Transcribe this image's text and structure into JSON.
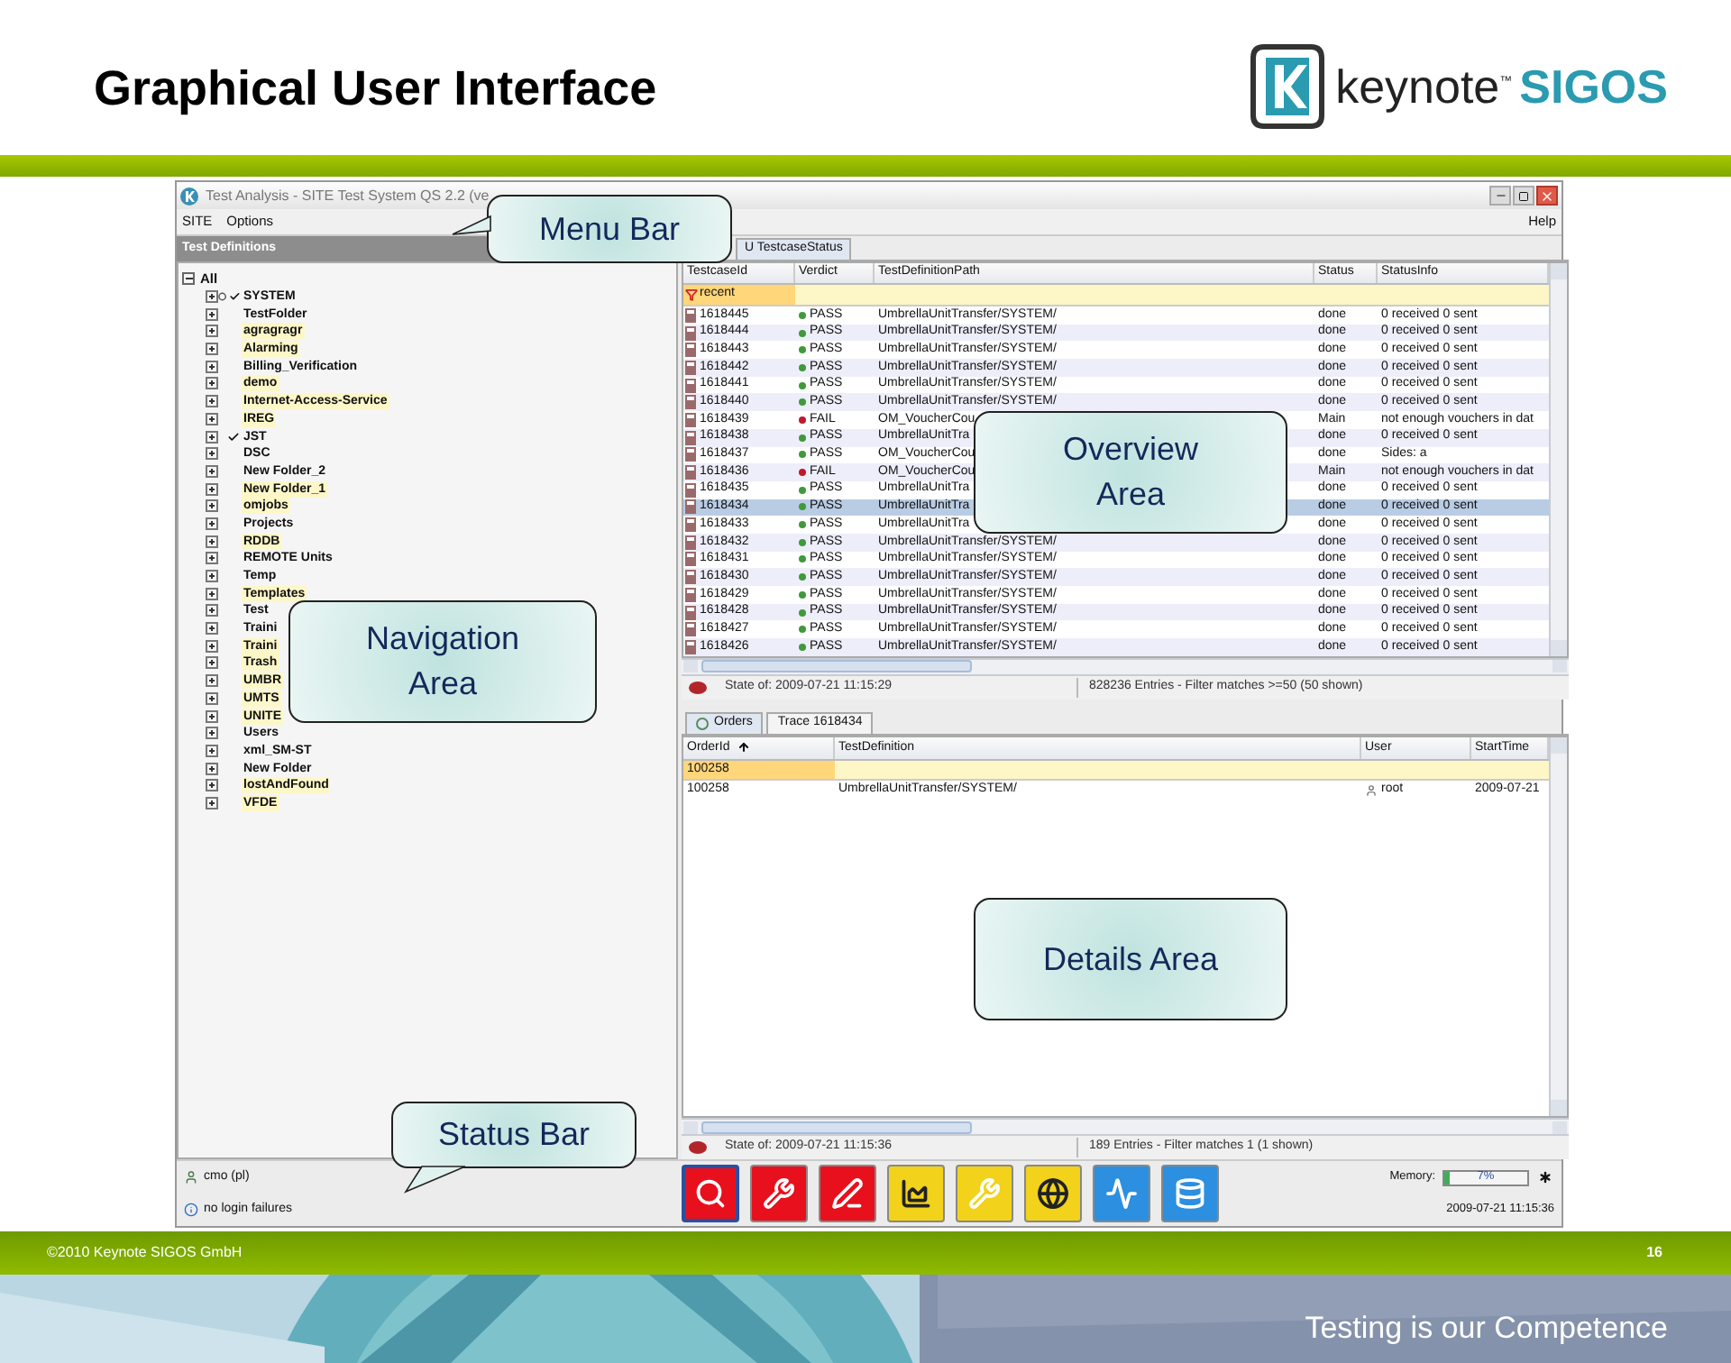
{
  "slide": {
    "title": "Graphical User Interface",
    "logo": {
      "word": "keynote",
      "mark": "™",
      "brand": "SIGOS"
    }
  },
  "window": {
    "title": "Test Analysis - SITE Test System QS 2.2 (ve",
    "menu": [
      "SITE",
      "Options"
    ],
    "help": "Help"
  },
  "navigation": {
    "header": "Test Definitions",
    "tree": {
      "label": "All",
      "expanded": true,
      "children": [
        {
          "label": "SYSTEM",
          "checked": true,
          "pinned": true,
          "highlighted": false,
          "expanded": false
        },
        {
          "label": "TestFolder",
          "checked": false,
          "pinned": false,
          "highlighted": false,
          "expanded": false
        },
        {
          "label": "agragragr",
          "checked": false,
          "pinned": false,
          "highlighted": true,
          "expanded": false
        },
        {
          "label": "Alarming",
          "checked": false,
          "pinned": false,
          "highlighted": true,
          "expanded": false
        },
        {
          "label": "Billing_Verification",
          "checked": false,
          "pinned": false,
          "highlighted": false,
          "expanded": false
        },
        {
          "label": "demo",
          "checked": false,
          "pinned": false,
          "highlighted": true,
          "expanded": false
        },
        {
          "label": "Internet-Access-Service",
          "checked": false,
          "pinned": false,
          "highlighted": true,
          "expanded": false
        },
        {
          "label": "IREG",
          "checked": false,
          "pinned": false,
          "highlighted": true,
          "expanded": false
        },
        {
          "label": "JST",
          "checked": true,
          "pinned": false,
          "highlighted": false,
          "expanded": false
        },
        {
          "label": "DSC",
          "checked": false,
          "pinned": false,
          "highlighted": false,
          "expanded": false
        },
        {
          "label": "New Folder_2",
          "checked": false,
          "pinned": false,
          "highlighted": false,
          "expanded": false
        },
        {
          "label": "New Folder_1",
          "checked": false,
          "pinned": false,
          "highlighted": true,
          "expanded": false
        },
        {
          "label": "omjobs",
          "checked": false,
          "pinned": false,
          "highlighted": true,
          "expanded": false
        },
        {
          "label": "Projects",
          "checked": false,
          "pinned": false,
          "highlighted": false,
          "expanded": false
        },
        {
          "label": "RDDB",
          "checked": false,
          "pinned": false,
          "highlighted": true,
          "expanded": false
        },
        {
          "label": "REMOTE Units",
          "checked": false,
          "pinned": false,
          "highlighted": false,
          "expanded": false
        },
        {
          "label": "Temp",
          "checked": false,
          "pinned": false,
          "highlighted": false,
          "expanded": false
        },
        {
          "label": "Templates",
          "checked": false,
          "pinned": false,
          "highlighted": true,
          "expanded": false
        },
        {
          "label": "Test",
          "checked": false,
          "pinned": false,
          "highlighted": false,
          "expanded": false
        },
        {
          "label": "Traini",
          "checked": false,
          "pinned": false,
          "highlighted": false,
          "expanded": false
        },
        {
          "label": "Traini",
          "checked": false,
          "pinned": false,
          "highlighted": true,
          "expanded": false
        },
        {
          "label": "Trash",
          "checked": false,
          "pinned": false,
          "highlighted": true,
          "expanded": false
        },
        {
          "label": "UMBR",
          "checked": false,
          "pinned": false,
          "highlighted": true,
          "expanded": false
        },
        {
          "label": "UMTS",
          "checked": false,
          "pinned": false,
          "highlighted": true,
          "expanded": false
        },
        {
          "label": "UNITE",
          "checked": false,
          "pinned": false,
          "highlighted": true,
          "expanded": false
        },
        {
          "label": "Users",
          "checked": false,
          "pinned": false,
          "highlighted": false,
          "expanded": false
        },
        {
          "label": "xml_SM-ST",
          "checked": false,
          "pinned": false,
          "highlighted": false,
          "expanded": false
        },
        {
          "label": "New Folder",
          "checked": false,
          "pinned": false,
          "highlighted": false,
          "expanded": false
        },
        {
          "label": "lostAndFound",
          "checked": false,
          "pinned": false,
          "highlighted": true,
          "expanded": false
        },
        {
          "label": "VFDE",
          "checked": false,
          "pinned": false,
          "highlighted": true,
          "expanded": false
        }
      ]
    }
  },
  "overview": {
    "tab": "U TestcaseStatus",
    "columns": [
      {
        "label": "TestcaseId"
      },
      {
        "label": "Verdict"
      },
      {
        "label": "TestDefinitionPath"
      },
      {
        "label": "Status"
      },
      {
        "label": "StatusInfo"
      }
    ],
    "filter": "recent",
    "rows": [
      {
        "id": "1618445",
        "verdict": "PASS",
        "kind": "pass",
        "path": "UmbrellaUnitTransfer/SYSTEM/",
        "status": "done",
        "info": "0 received 0 sent",
        "selected": false
      },
      {
        "id": "1618444",
        "verdict": "PASS",
        "kind": "pass",
        "path": "UmbrellaUnitTransfer/SYSTEM/",
        "status": "done",
        "info": "0 received 0 sent",
        "selected": false
      },
      {
        "id": "1618443",
        "verdict": "PASS",
        "kind": "pass",
        "path": "UmbrellaUnitTransfer/SYSTEM/",
        "status": "done",
        "info": "0 received 0 sent",
        "selected": false
      },
      {
        "id": "1618442",
        "verdict": "PASS",
        "kind": "pass",
        "path": "UmbrellaUnitTransfer/SYSTEM/",
        "status": "done",
        "info": "0 received 0 sent",
        "selected": false
      },
      {
        "id": "1618441",
        "verdict": "PASS",
        "kind": "pass",
        "path": "UmbrellaUnitTransfer/SYSTEM/",
        "status": "done",
        "info": "0 received 0 sent",
        "selected": false
      },
      {
        "id": "1618440",
        "verdict": "PASS",
        "kind": "pass",
        "path": "UmbrellaUnitTransfer/SYSTEM/",
        "status": "done",
        "info": "0 received 0 sent",
        "selected": false
      },
      {
        "id": "1618439",
        "verdict": "FAIL",
        "kind": "fail",
        "path": "OM_VoucherCou",
        "status": "Main",
        "info": "not enough vouchers in dat",
        "selected": false
      },
      {
        "id": "1618438",
        "verdict": "PASS",
        "kind": "pass",
        "path": "UmbrellaUnitTra",
        "status": "done",
        "info": "0 received 0 sent",
        "selected": false
      },
      {
        "id": "1618437",
        "verdict": "PASS",
        "kind": "pass",
        "path": "OM_VoucherCou",
        "status": "done",
        "info": "Sides: a",
        "selected": false
      },
      {
        "id": "1618436",
        "verdict": "FAIL",
        "kind": "fail",
        "path": "OM_VoucherCou",
        "status": "Main",
        "info": "not enough vouchers in dat",
        "selected": false
      },
      {
        "id": "1618435",
        "verdict": "PASS",
        "kind": "pass",
        "path": "UmbrellaUnitTra",
        "status": "done",
        "info": "0 received 0 sent",
        "selected": false
      },
      {
        "id": "1618434",
        "verdict": "PASS",
        "kind": "pass",
        "path": "UmbrellaUnitTra",
        "status": "done",
        "info": "0 received 0 sent",
        "selected": true
      },
      {
        "id": "1618433",
        "verdict": "PASS",
        "kind": "pass",
        "path": "UmbrellaUnitTra",
        "status": "done",
        "info": "0 received 0 sent",
        "selected": false
      },
      {
        "id": "1618432",
        "verdict": "PASS",
        "kind": "pass",
        "path": "UmbrellaUnitTransfer/SYSTEM/",
        "status": "done",
        "info": "0 received 0 sent",
        "selected": false
      },
      {
        "id": "1618431",
        "verdict": "PASS",
        "kind": "pass",
        "path": "UmbrellaUnitTransfer/SYSTEM/",
        "status": "done",
        "info": "0 received 0 sent",
        "selected": false
      },
      {
        "id": "1618430",
        "verdict": "PASS",
        "kind": "pass",
        "path": "UmbrellaUnitTransfer/SYSTEM/",
        "status": "done",
        "info": "0 received 0 sent",
        "selected": false
      },
      {
        "id": "1618429",
        "verdict": "PASS",
        "kind": "pass",
        "path": "UmbrellaUnitTransfer/SYSTEM/",
        "status": "done",
        "info": "0 received 0 sent",
        "selected": false
      },
      {
        "id": "1618428",
        "verdict": "PASS",
        "kind": "pass",
        "path": "UmbrellaUnitTransfer/SYSTEM/",
        "status": "done",
        "info": "0 received 0 sent",
        "selected": false
      },
      {
        "id": "1618427",
        "verdict": "PASS",
        "kind": "pass",
        "path": "UmbrellaUnitTransfer/SYSTEM/",
        "status": "done",
        "info": "0 received 0 sent",
        "selected": false
      },
      {
        "id": "1618426",
        "verdict": "PASS",
        "kind": "pass",
        "path": "UmbrellaUnitTransfer/SYSTEM/",
        "status": "done",
        "info": "0 received 0 sent",
        "selected": false
      }
    ],
    "state": "State of: 2009-07-21 11:15:29",
    "entries": "828236 Entries - Filter matches >=50 (50 shown)"
  },
  "details": {
    "tabs": [
      {
        "label": "Orders",
        "selected": true
      },
      {
        "label": "Trace 1618434",
        "selected": false
      }
    ],
    "columns": [
      {
        "label": "OrderId",
        "sorted_ascending": true
      },
      {
        "label": "TestDefinition"
      },
      {
        "label": "User"
      },
      {
        "label": "StartTime"
      }
    ],
    "filter": "100258",
    "rows": [
      {
        "order_id": "100258",
        "test_definition": "UmbrellaUnitTransfer/SYSTEM/",
        "user": "root",
        "start_time": "2009-07-21"
      }
    ],
    "state": "State of: 2009-07-21 11:15:36",
    "entries": "189 Entries - Filter matches 1 (1 shown)"
  },
  "status_bar": {
    "user": "cmo (pl)",
    "login": "no login failures",
    "toolbar": [
      {
        "kind": "search",
        "color": "#e8101c",
        "selected": true
      },
      {
        "kind": "tools",
        "color": "#e8101c",
        "selected": false
      },
      {
        "kind": "edit",
        "color": "#e8101c",
        "selected": false
      },
      {
        "kind": "chart",
        "color": "#f2d21a",
        "selected": false
      },
      {
        "kind": "tools",
        "color": "#f2d21a",
        "selected": false
      },
      {
        "kind": "globe",
        "color": "#f2d21a",
        "selected": false
      },
      {
        "kind": "monitor",
        "color": "#2d8fe0",
        "selected": false
      },
      {
        "kind": "database",
        "color": "#2d8fe0",
        "selected": false
      }
    ],
    "memory_label": "Memory:",
    "memory": {
      "level": 0.07,
      "reading": "7%"
    },
    "time": "2009-07-21 11:15:36"
  },
  "callouts": [
    {
      "kind": "menu",
      "text": "Menu Bar"
    },
    {
      "kind": "overview",
      "text": "Overview Area"
    },
    {
      "kind": "navigation",
      "text": "Navigation Area"
    },
    {
      "kind": "details",
      "text": "Details Area"
    },
    {
      "kind": "status",
      "text": "Status Bar"
    }
  ],
  "footer": {
    "copyright": "©2010 Keynote SIGOS GmbH",
    "page": "16",
    "slogan": "Testing is our Competence"
  }
}
